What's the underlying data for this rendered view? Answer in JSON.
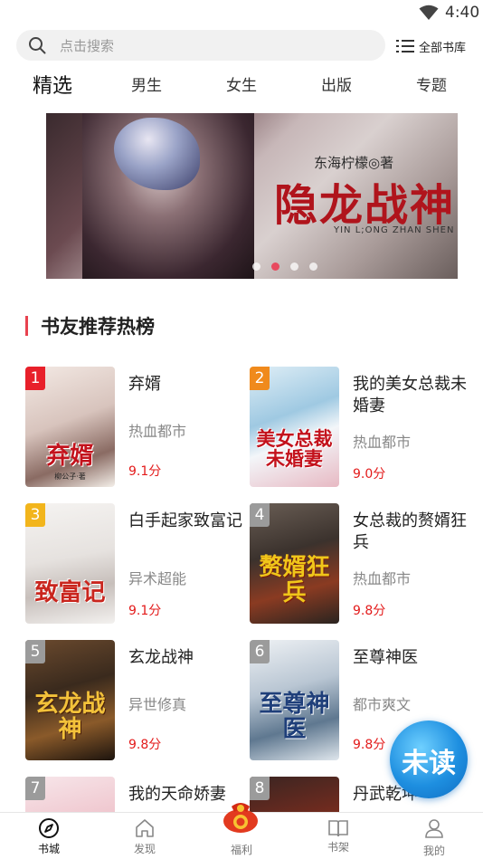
{
  "status": {
    "time": "4:40"
  },
  "search": {
    "placeholder": "点击搜索",
    "library_label": "全部书库"
  },
  "tabs": [
    {
      "label": "精选",
      "active": true
    },
    {
      "label": "男生"
    },
    {
      "label": "女生"
    },
    {
      "label": "出版"
    },
    {
      "label": "专题"
    }
  ],
  "banner": {
    "author": "东海柠檬◎著",
    "title": "隐龙战神",
    "pinyin": "YIN L;ONG ZHAN SHEN",
    "active_dot": 1,
    "dot_count": 4
  },
  "section": {
    "title": "书友推荐热榜"
  },
  "books": [
    {
      "rank": "1",
      "name": "弃婿",
      "genre": "热血都市",
      "score": "9.1分",
      "cover_title": "弃婿",
      "cover_author": "柳公子·著"
    },
    {
      "rank": "2",
      "name": "我的美女总裁未婚妻",
      "genre": "热血都市",
      "score": "9.0分",
      "cover_title": "美女总裁未婚妻",
      "cover_author": ""
    },
    {
      "rank": "3",
      "name": "白手起家致富记",
      "genre": "异术超能",
      "score": "9.1分",
      "cover_title": "致富记",
      "cover_author": ""
    },
    {
      "rank": "4",
      "name": "女总裁的赘婿狂兵",
      "genre": "热血都市",
      "score": "9.8分",
      "cover_title": "赘婿狂兵",
      "cover_author": ""
    },
    {
      "rank": "5",
      "name": "玄龙战神",
      "genre": "异世修真",
      "score": "9.8分",
      "cover_title": "玄龙战神",
      "cover_author": ""
    },
    {
      "rank": "6",
      "name": "至尊神医",
      "genre": "都市爽文",
      "score": "9.8分",
      "cover_title": "至尊神医",
      "cover_author": ""
    },
    {
      "rank": "7",
      "name": "我的天命娇妻",
      "genre": "",
      "score": "",
      "cover_title": "",
      "cover_author": ""
    },
    {
      "rank": "8",
      "name": "丹武乾坤",
      "genre": "",
      "score": "",
      "cover_title": "",
      "cover_author": ""
    }
  ],
  "float_button": {
    "label": "未读"
  },
  "nav": [
    {
      "label": "书城",
      "icon": "compass-icon",
      "active": true
    },
    {
      "label": "发现",
      "icon": "home-icon"
    },
    {
      "label": "福利",
      "icon": "gift-bag-icon"
    },
    {
      "label": "书架",
      "icon": "book-icon"
    },
    {
      "label": "我的",
      "icon": "person-icon"
    }
  ],
  "colors": {
    "accent": "#e8424f",
    "score": "#e31a1a",
    "rank1": "#e8202a",
    "rank2": "#f08a1c",
    "rank3": "#f2b51c",
    "rank_other": "#9b9b9b",
    "float": "#1e8fe0"
  }
}
